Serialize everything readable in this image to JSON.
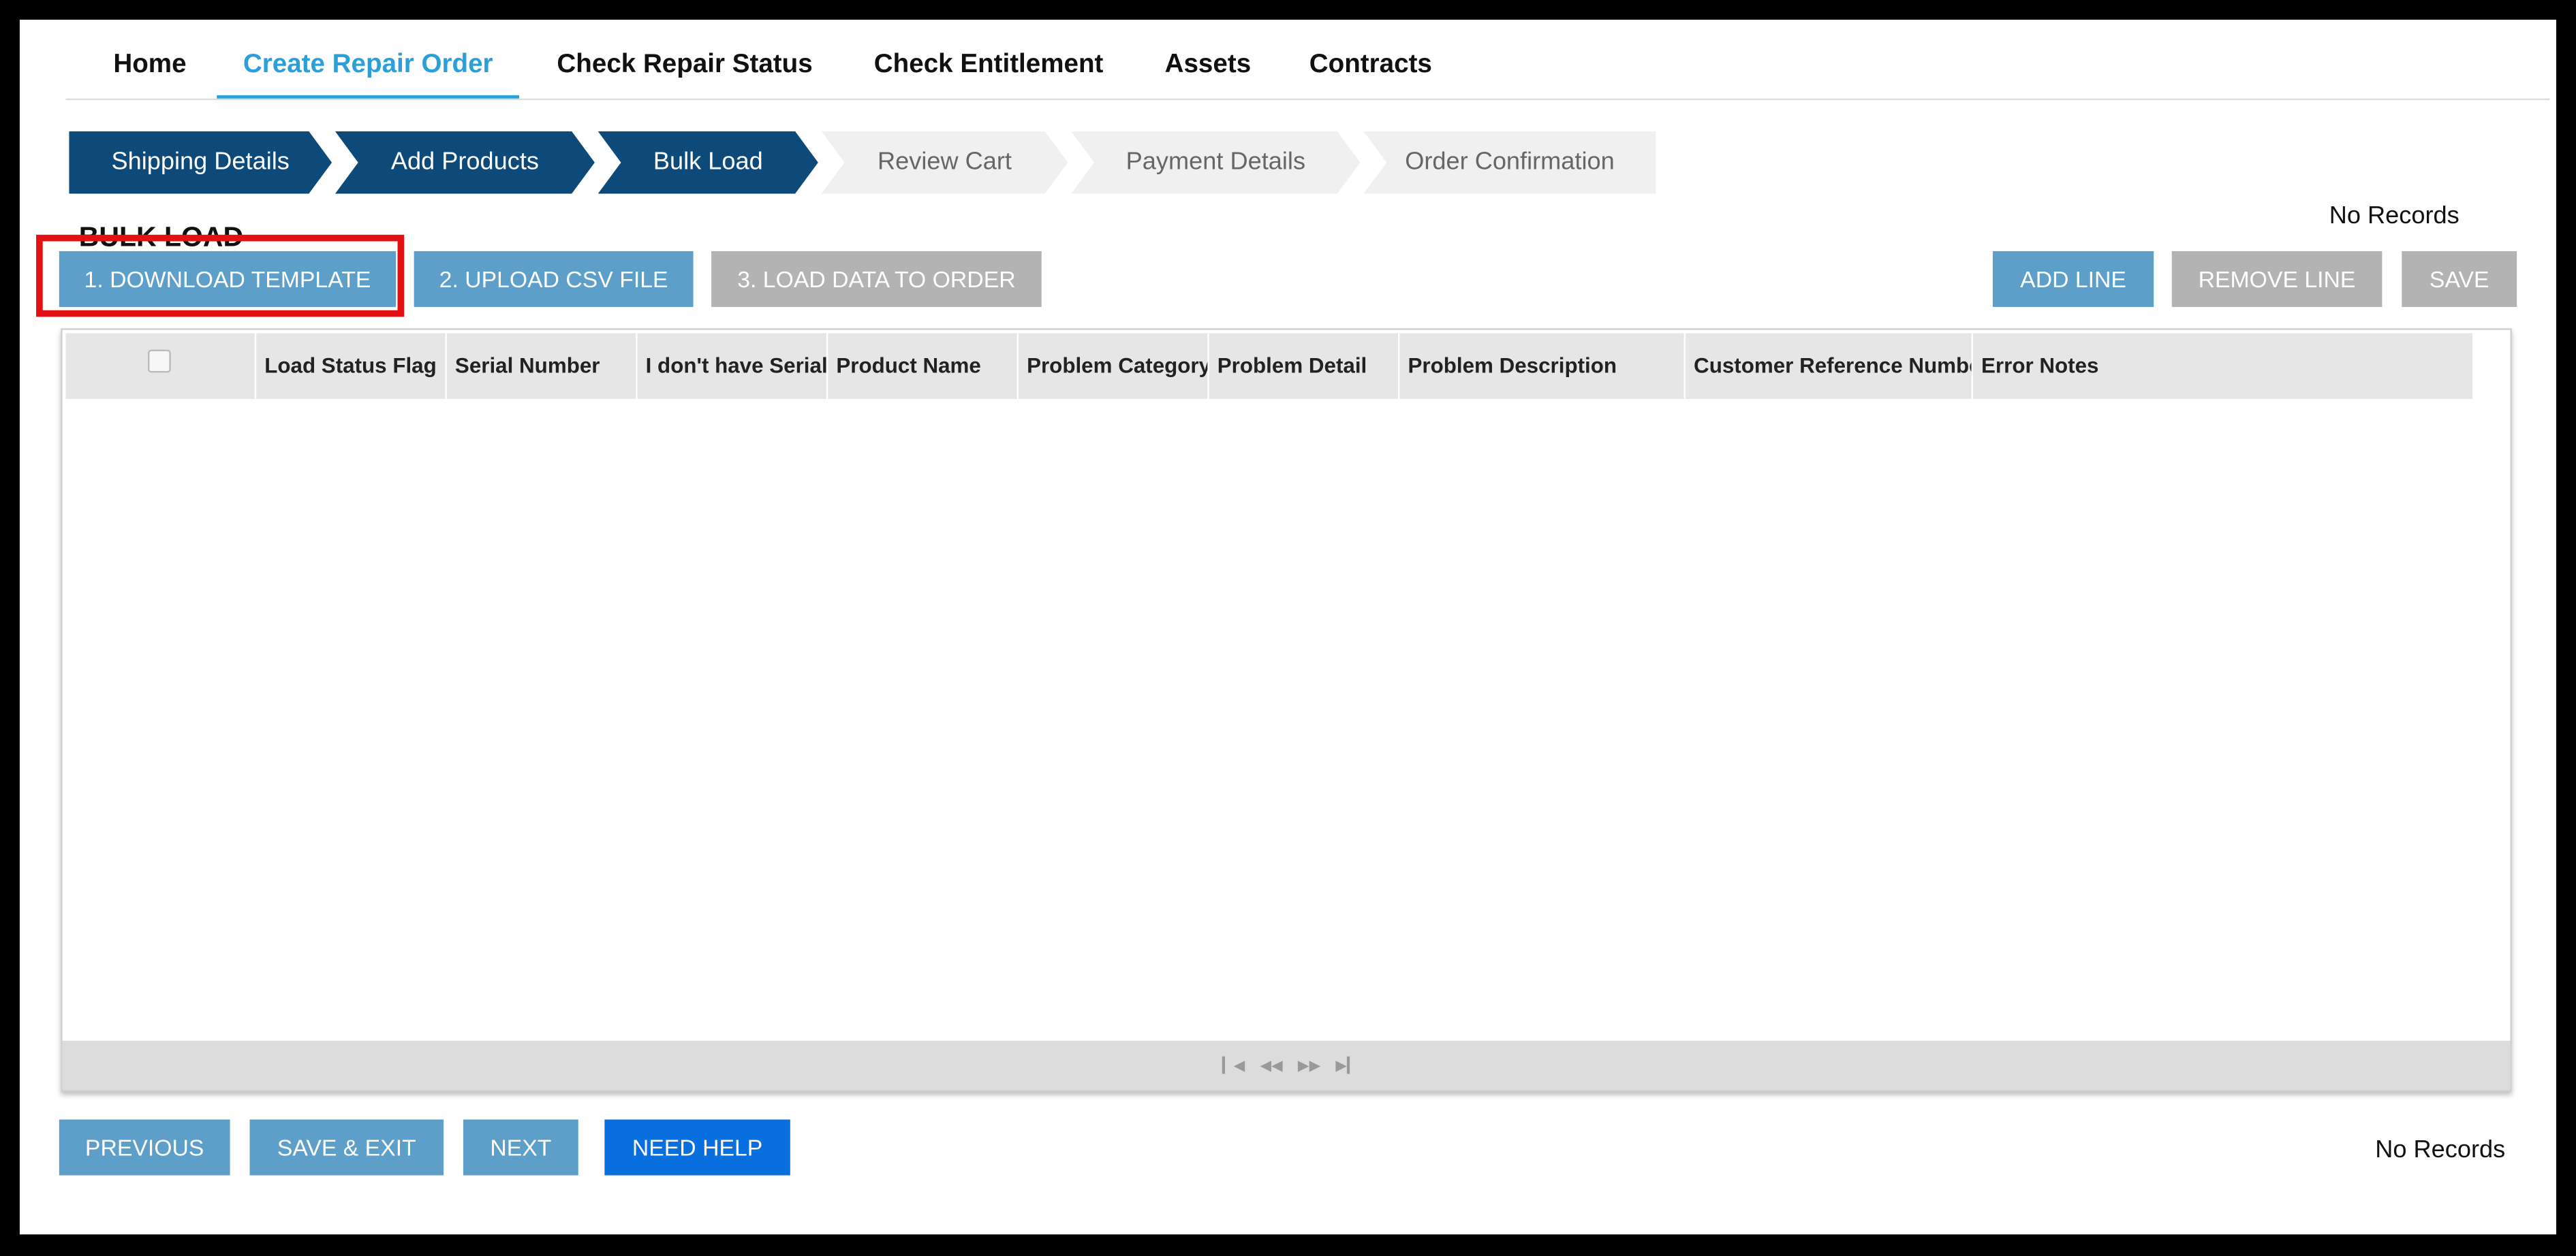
{
  "nav": {
    "home": "Home",
    "create_repair_order": "Create Repair Order",
    "check_repair_status": "Check Repair Status",
    "check_entitlement": "Check Entitlement",
    "assets": "Assets",
    "contracts": "Contracts",
    "active": "Create Repair Order"
  },
  "steps": [
    {
      "label": "Shipping Details",
      "state": "completed"
    },
    {
      "label": "Add Products",
      "state": "completed"
    },
    {
      "label": "Bulk Load",
      "state": "current"
    },
    {
      "label": "Review Cart",
      "state": "pending"
    },
    {
      "label": "Payment Details",
      "state": "pending"
    },
    {
      "label": "Order Confirmation",
      "state": "pending"
    }
  ],
  "section_title": "BULK LOAD",
  "records_top": "No Records",
  "records_bottom": "No Records",
  "buttons": {
    "download_template": "1. DOWNLOAD TEMPLATE",
    "upload_csv": "2. UPLOAD CSV FILE",
    "load_data": "3. LOAD DATA TO ORDER",
    "add_line": "ADD LINE",
    "remove_line": "REMOVE LINE",
    "save": "SAVE",
    "previous": "PREVIOUS",
    "save_exit": "SAVE & EXIT",
    "next": "NEXT",
    "need_help": "NEED HELP"
  },
  "grid": {
    "columns": [
      "Load Status Flag",
      "Serial Number",
      "I don't have Serial",
      "Product Name",
      "Problem Category",
      "Problem Detail",
      "Problem Description",
      "Customer Reference Number",
      "Error Notes"
    ],
    "rows": []
  },
  "pager": {
    "first": "first-page-icon",
    "prev": "prev-page-icon",
    "next": "next-page-icon",
    "last": "last-page-icon"
  },
  "colors": {
    "step_done": "#0d4a7a",
    "accent": "#2b9fd9",
    "button_blue": "#5d9fc9",
    "button_grey": "#b3b3b3",
    "need_help": "#0a6fde",
    "highlight": "#e21212"
  }
}
